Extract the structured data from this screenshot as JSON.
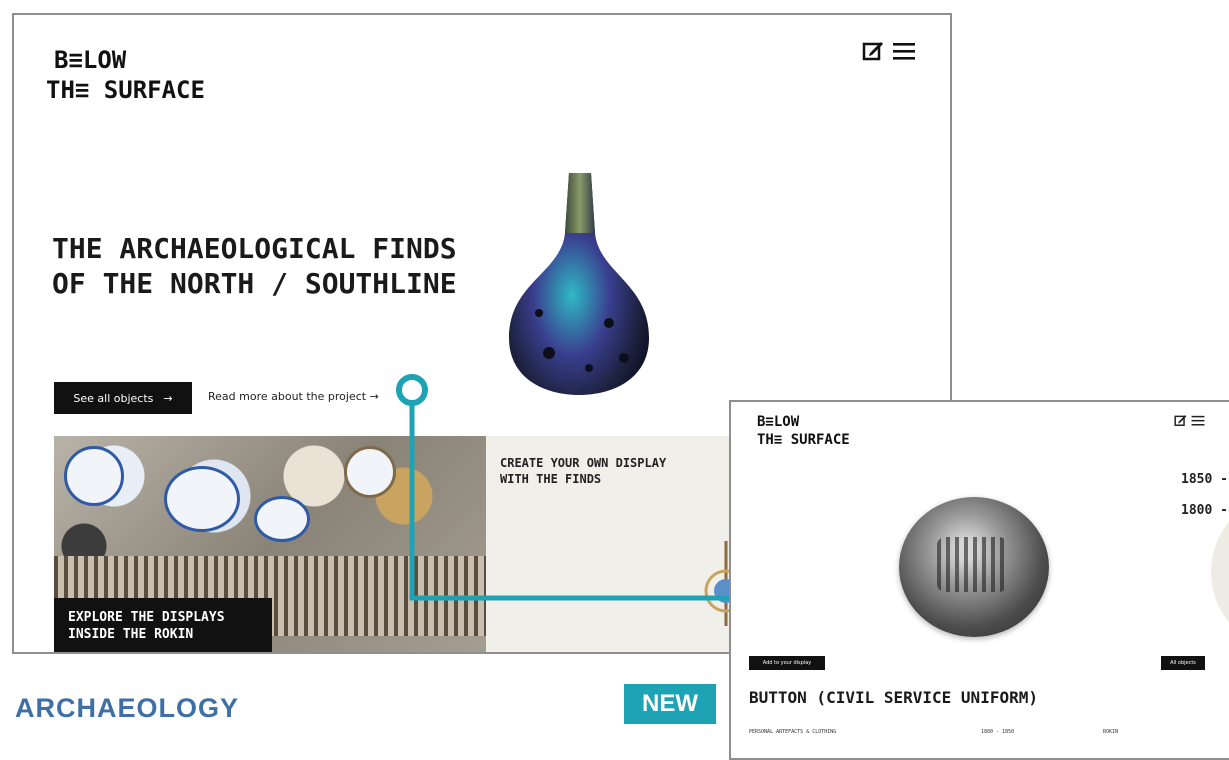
{
  "site": {
    "logo_line1": "B≡LOW",
    "logo_line2": "TH≡ SURFACE"
  },
  "header_icons": [
    "edit-icon",
    "menu-icon"
  ],
  "hero": {
    "title": "THE ARCHAEOLOGICAL FINDS OF THE NORTH / SOUTHLINE",
    "primary_button": "See all objects",
    "secondary_link": "Read more about the project →"
  },
  "tiles": {
    "explore": "EXPLORE THE DISPLAYS INSIDE THE ROKIN",
    "create": "CREATE YOUR OWN DISPLAY WITH THE FINDS"
  },
  "detail_page": {
    "logo_line1": "B≡LOW",
    "logo_line2": "TH≡ SURFACE",
    "dates": [
      "1850 -",
      "1800 -"
    ],
    "left_button": "Add to your display",
    "right_button": "All objects",
    "object_title": "BUTTON (CIVIL SERVICE UNIFORM)",
    "meta": [
      "PERSONAL ARTEFACTS & CLOTHING",
      "1800 - 1850",
      "ROKIN"
    ]
  },
  "badge": "NEW",
  "caption": "ARCHAEOLOGY",
  "colors": {
    "accent_teal": "#1ea3b5",
    "caption_blue": "#3e6fa5"
  }
}
